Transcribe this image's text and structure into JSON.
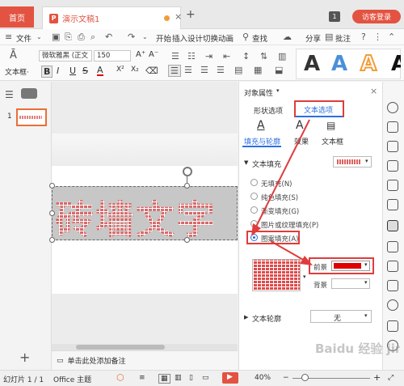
{
  "tabs": {
    "home": "首页",
    "document": "演示文稿1",
    "new_tab": "+",
    "badge": "1",
    "login": "访客登录"
  },
  "menu": {
    "file": "文件",
    "items": [
      "开始",
      "插入",
      "设计",
      "切换",
      "动画"
    ],
    "search": "查找",
    "share": "分享",
    "comment": "批注"
  },
  "ribbon": {
    "textbox_label": "文本框·",
    "font": "微软雅黑 (正文",
    "size": "150",
    "grow": "A⁺",
    "shrink": "A⁻",
    "format_buttons": [
      "B",
      "I",
      "U",
      "S",
      "A",
      "X²",
      "X₂",
      "⌫"
    ],
    "styles": [
      {
        "letter": "A",
        "color": "#111111"
      },
      {
        "letter": "A",
        "color": "#4a90d9"
      },
      {
        "letter": "A",
        "color": "#f29c38"
      }
    ]
  },
  "slides": {
    "number": "1"
  },
  "canvas": {
    "text": "砖墙文字",
    "notes": "单击此处添加备注"
  },
  "panel": {
    "title": "对象属性",
    "tabs": [
      "形状选项",
      "文本选项"
    ],
    "subtabs": [
      "填充与轮廓",
      "效果",
      "文本框"
    ],
    "fill_section": "文本填充",
    "fill_options": [
      "无填充(N)",
      "纯色填充(S)",
      "渐变填充(G)",
      "图片或纹理填充(P)",
      "图案填充(A)"
    ],
    "foreground_label": "前景",
    "background_label": "背景",
    "foreground_color": "#e00000",
    "outline_label": "文本轮廓",
    "outline_value": "无"
  },
  "status": {
    "slide": "幻灯片 1 / 1",
    "theme": "Office 主题",
    "zoom": "40%",
    "plus": "+",
    "minus": "−"
  },
  "watermark": "Baidu 经验 jingyan.baidu.com"
}
